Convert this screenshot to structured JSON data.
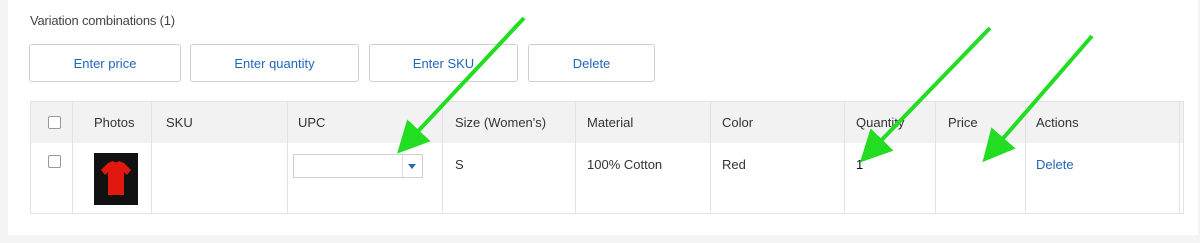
{
  "section": {
    "title": "Variation combinations (1)"
  },
  "toolbar": {
    "enter_price": "Enter price",
    "enter_quantity": "Enter quantity",
    "enter_sku": "Enter SKU",
    "delete": "Delete"
  },
  "table": {
    "headers": [
      "Photos",
      "SKU",
      "UPC",
      "Size (Women's)",
      "Material",
      "Color",
      "Quantity",
      "Price",
      "Actions"
    ],
    "rows": [
      {
        "photo": "red-tshirt-icon",
        "sku": "",
        "upc": "",
        "size": "S",
        "material": "100% Cotton",
        "color": "Red",
        "quantity": "1",
        "price": "",
        "action": "Delete"
      }
    ]
  },
  "colors": {
    "accent": "#2266bb",
    "annotation_arrow": "#22dd22",
    "header_bg": "#f2f2f2"
  }
}
